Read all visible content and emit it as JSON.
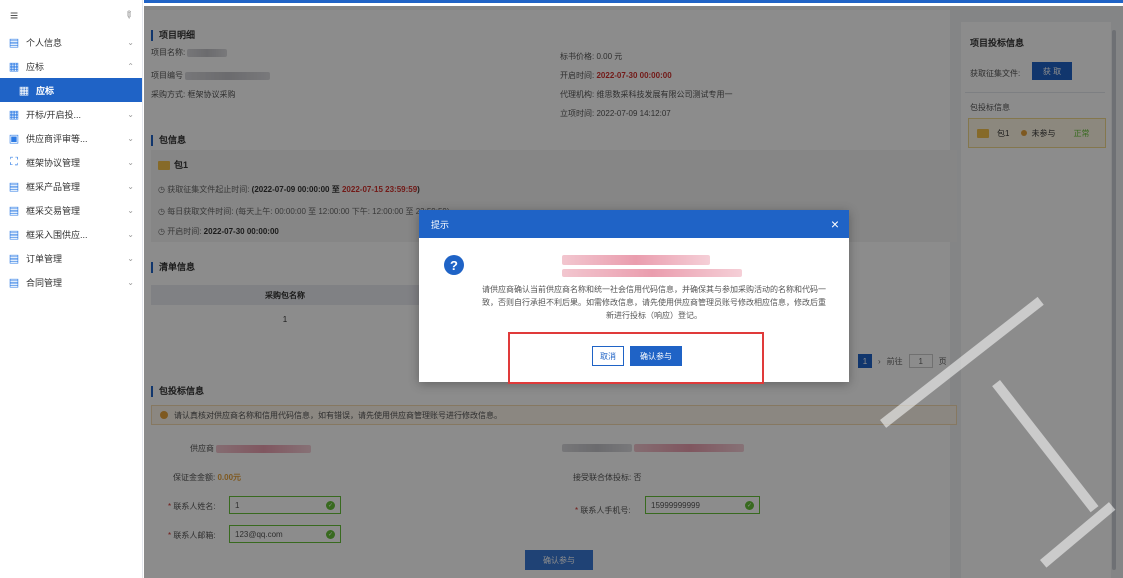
{
  "sidebar": {
    "items": [
      {
        "label": "个人信息",
        "icon": "profile-icon"
      },
      {
        "label": "应标",
        "icon": "bid-icon"
      },
      {
        "label": "应标",
        "icon": "bid-icon",
        "active": true
      },
      {
        "label": "开标/开启投...",
        "icon": "open-bid-icon"
      },
      {
        "label": "供应商评审等...",
        "icon": "review-icon"
      },
      {
        "label": "框架协议管理",
        "icon": "agreement-icon"
      },
      {
        "label": "框采产品管理",
        "icon": "product-icon"
      },
      {
        "label": "框采交易管理",
        "icon": "trade-icon"
      },
      {
        "label": "框采入围供应...",
        "icon": "supplier-icon"
      },
      {
        "label": "订单管理",
        "icon": "order-icon"
      },
      {
        "label": "合同管理",
        "icon": "contract-icon"
      }
    ]
  },
  "project": {
    "section_title": "项目明细",
    "name_label": "项目名称:",
    "code_label": "项目编号",
    "method_label": "采购方式:",
    "method_value": "框架协议采购",
    "price_label": "标书价格:",
    "price_value": "0.00 元",
    "open_label": "开启时间:",
    "open_value": "2022-07-30 00:00:00",
    "agency_label": "代理机构:",
    "agency_value": "维思数采科技发展有限公司测试专用一",
    "setup_label": "立项时间:",
    "setup_value": "2022-07-09 14:12:07"
  },
  "package": {
    "section_title": "包信息",
    "name": "包1",
    "line1_label": "获取征集文件起止时间:",
    "line1_start": "(2022-07-09 00:00:00",
    "line1_sep": "至",
    "line1_end": "2022-07-15 23:59:59",
    "line1_close": ")",
    "line2": "每日获取文件时间: (每天上午: 00:00:00 至 12:00:00  下午: 12:00:00 至 23:59:59)",
    "line3_label": "开启时间:",
    "line3_value": "2022-07-30 00:00:00"
  },
  "list": {
    "section_title": "清单信息",
    "col_header": "采购包名称",
    "cell": "1"
  },
  "pager": {
    "current": "1",
    "goto_label": "前往",
    "goto_value": "1",
    "page_suffix": "页"
  },
  "bid_info": {
    "section_title": "包投标信息",
    "notice": "请认真核对供应商名称和信用代码信息，如有错误，请先使用供应商管理账号进行修改信息。",
    "supplier_label": "供应商",
    "deposit_label": "保证金金额:",
    "deposit_value": "0.00元",
    "joint_label": "接受联合体投标:",
    "joint_value": "否",
    "contact_name_label": "联系人姓名:",
    "contact_name_value": "1",
    "contact_phone_label": "联系人手机号:",
    "contact_phone_value": "15999999999",
    "contact_email_label": "联系人邮箱:",
    "contact_email_value": "123@qq.com",
    "submit_label": "确认参与"
  },
  "right_panel": {
    "title": "项目投标信息",
    "get_file_label": "获取征集文件:",
    "get_button": "获 取",
    "sub_title": "包投标信息",
    "pkg_name": "包1",
    "pkg_status": "未参与",
    "pkg_state": "正常"
  },
  "modal": {
    "title": "提示",
    "close": "×",
    "message": "请供应商确认当前供应商名称和统一社会信用代码信息，并确保其与参加采购活动的名称和代码一致，否则自行承担不利后果。如需修改信息，请先使用供应商管理员账号修改相应信息，修改后重新进行投标（响应）登记。",
    "cancel_label": "取消",
    "confirm_label": "确认参与"
  },
  "colors": {
    "primary": "#1f63c6",
    "danger": "#d0312d",
    "success": "#67c23a",
    "warning": "#e6a23c"
  }
}
